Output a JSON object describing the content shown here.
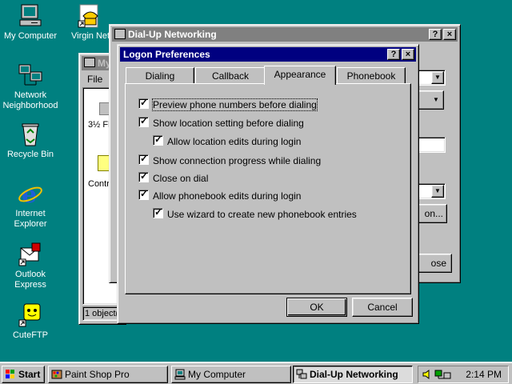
{
  "desktop": {
    "icons": [
      {
        "label": "My Computer"
      },
      {
        "label": "Network Neighborhood"
      },
      {
        "label": "Recycle Bin"
      },
      {
        "label": "Internet Explorer"
      },
      {
        "label": "Outlook Express"
      },
      {
        "label": "CuteFTP"
      },
      {
        "label": "Virgin Net"
      }
    ]
  },
  "mycomputer": {
    "title": "My",
    "menu_file": "File",
    "item_floppy": "3½ Fl",
    "item_control": "Contr",
    "status": "1 object(s"
  },
  "dun": {
    "title": "Dial-Up Networking",
    "btn_help": "?",
    "btn_close": "×",
    "btn_ellipsis": "on...",
    "btn_close_label": "ose"
  },
  "dialog": {
    "title": "Logon Preferences",
    "btn_help": "?",
    "btn_close": "×",
    "tabs": [
      "Dialing",
      "Callback",
      "Appearance",
      "Phonebook"
    ],
    "active_tab": "Appearance",
    "options": [
      {
        "label": "Preview phone numbers before dialing",
        "checked": true,
        "indent": 0,
        "focused": true
      },
      {
        "label": "Show location setting before dialing",
        "checked": true,
        "indent": 0
      },
      {
        "label": "Allow location edits during login",
        "checked": true,
        "indent": 1
      },
      {
        "label": "Show connection progress while dialing",
        "checked": true,
        "indent": 0
      },
      {
        "label": "Close on dial",
        "checked": true,
        "indent": 0
      },
      {
        "label": "Allow phonebook edits during login",
        "checked": true,
        "indent": 0
      },
      {
        "label": "Use wizard to create new phonebook entries",
        "checked": true,
        "indent": 1
      }
    ],
    "ok_label": "OK",
    "cancel_label": "Cancel"
  },
  "taskbar": {
    "start_label": "Start",
    "tasks": [
      {
        "label": "Paint Shop Pro",
        "pressed": false
      },
      {
        "label": "My Computer",
        "pressed": false
      },
      {
        "label": "Dial-Up Networking",
        "pressed": true
      }
    ],
    "clock": "2:14 PM"
  },
  "colors": {
    "desktop": "#008080",
    "title_active": "#000080",
    "title_inactive": "#808080",
    "face": "#c0c0c0"
  }
}
